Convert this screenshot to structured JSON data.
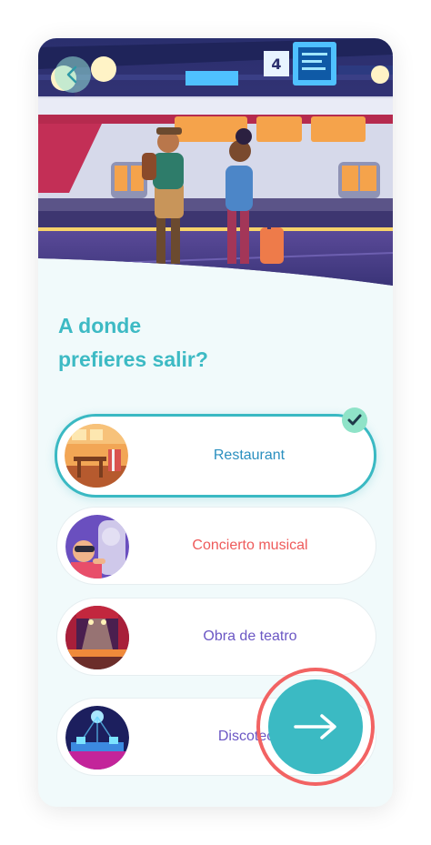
{
  "screen": {
    "question": "A donde\nprefieres salir?",
    "back_icon": "chevron-left-icon",
    "next_icon": "arrow-right-icon",
    "check_icon": "checkmark-icon",
    "colors": {
      "accent": "#3bbac3",
      "title": "#3dbac4",
      "ring": "#f26363",
      "check_bg": "#8fe3c8"
    }
  },
  "options": [
    {
      "label": "Restaurant",
      "color": "#2a8fbf",
      "selected": true
    },
    {
      "label": "Concierto musical",
      "color": "#ee5a5a",
      "selected": false
    },
    {
      "label": "Obra de teatro",
      "color": "#6b57c4",
      "selected": false
    },
    {
      "label": "Discoteca",
      "color": "#6b57c4",
      "selected": false
    }
  ]
}
